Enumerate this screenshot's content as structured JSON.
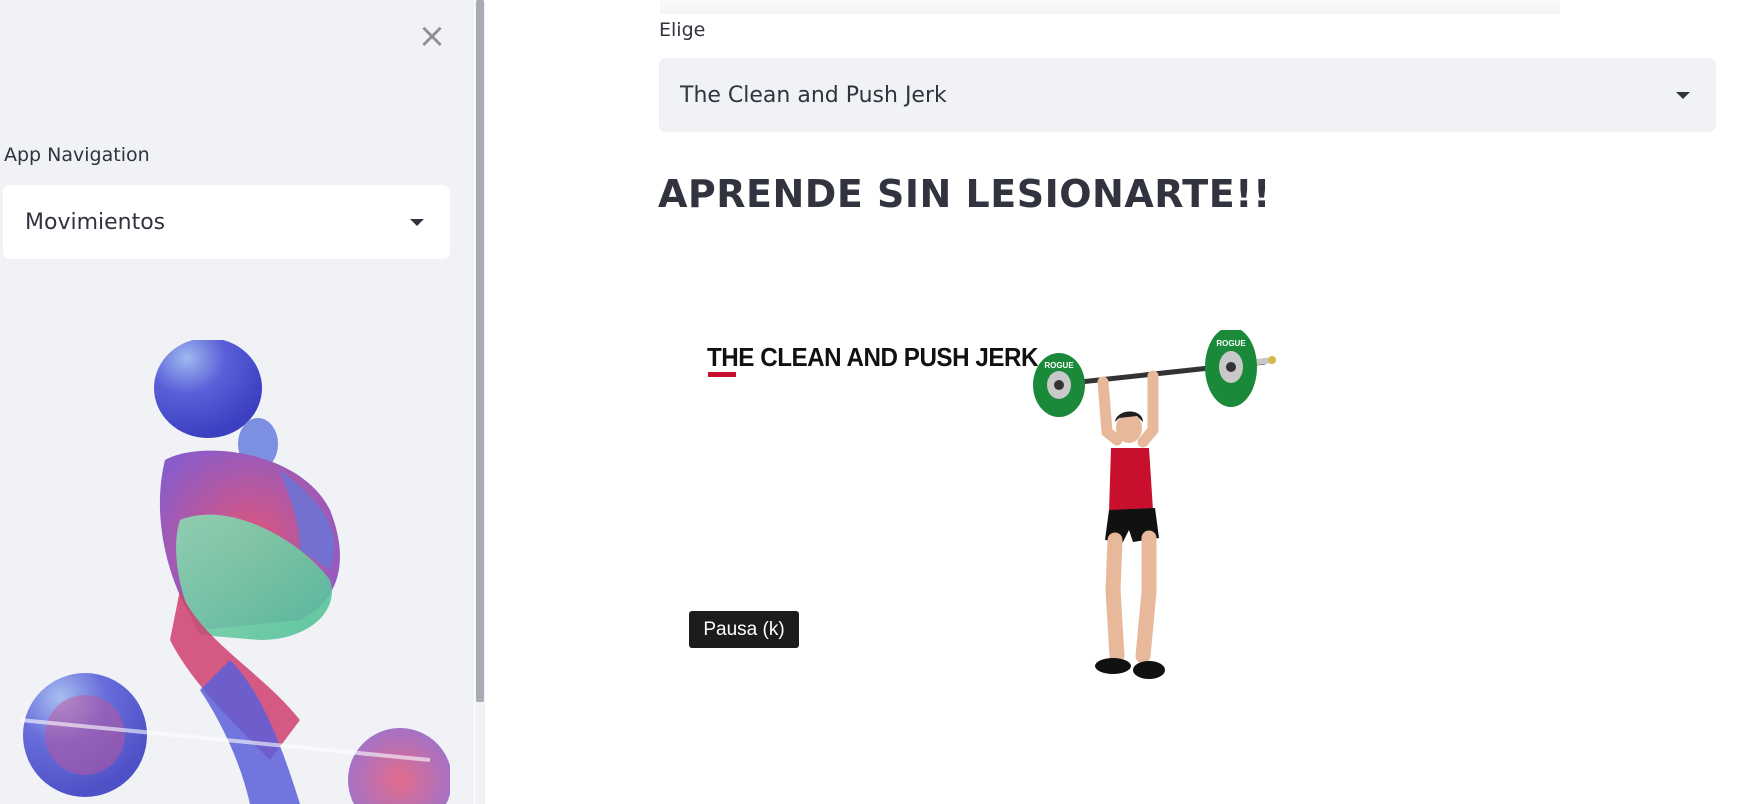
{
  "sidebar": {
    "close_icon": "close-icon",
    "nav_label": "App Navigation",
    "nav_selected": "Movimientos",
    "illustration": "watercolor weightlifter silhouette"
  },
  "main": {
    "select_label": "Elige",
    "select_value": "The Clean and Push Jerk",
    "heading": "APRENDE SIN LESIONARTE!!",
    "video": {
      "title": "THE CLEAN AND PUSH JERK",
      "plate_text": "ROGUE"
    },
    "tooltip": "Pausa (k)"
  },
  "colors": {
    "sidebar_bg": "#f0f2f6",
    "text": "#31333f",
    "accent_red": "#c8102e",
    "plate_green": "#1a8a3a"
  }
}
